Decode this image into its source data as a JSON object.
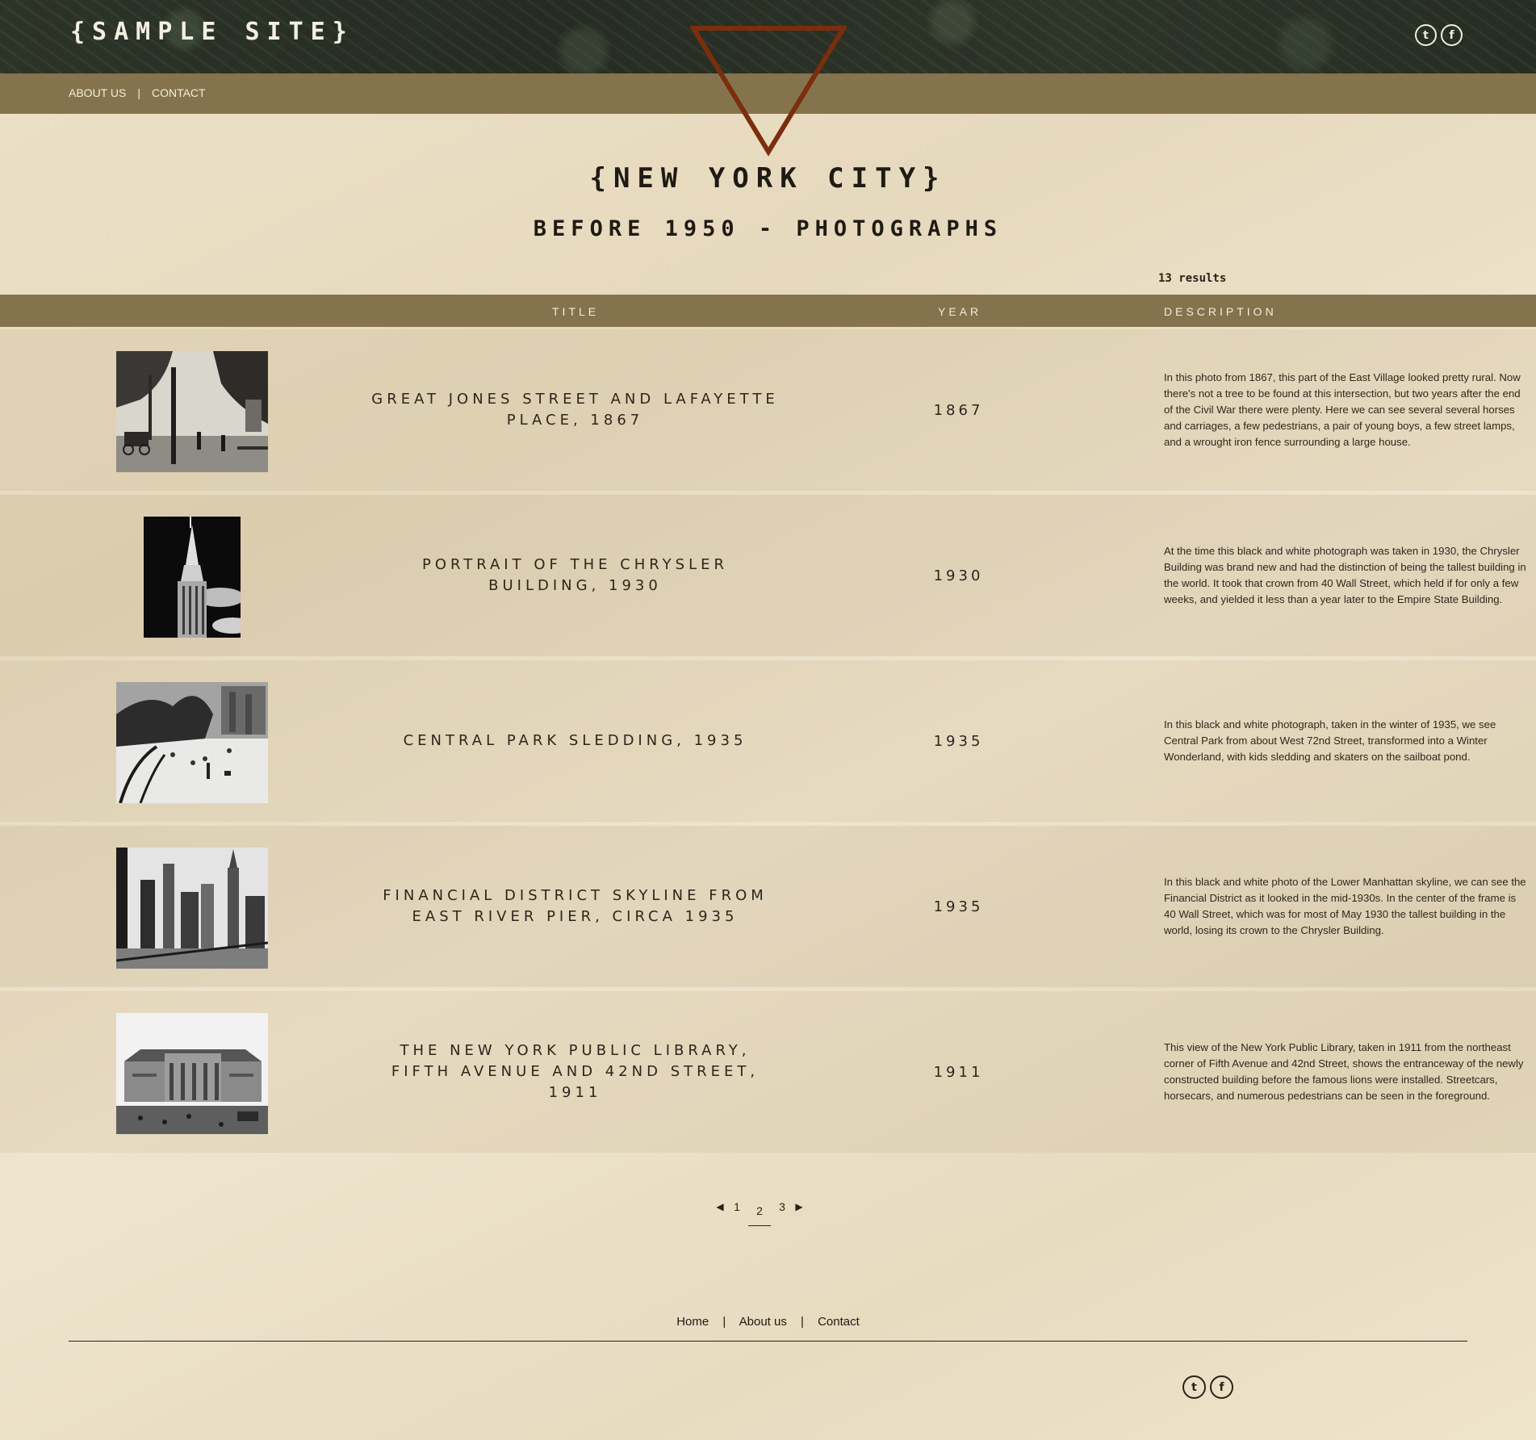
{
  "site": {
    "logo": "{SAMPLE SITE}"
  },
  "social": {
    "twitter_icon": "twitter-icon",
    "facebook_icon": "facebook-icon",
    "twitter_glyph": "t",
    "facebook_glyph": "f"
  },
  "nav": {
    "about": "ABOUT US",
    "separator": "|",
    "contact": "CONTACT"
  },
  "hero": {
    "city": "{NEW YORK CITY}",
    "subtitle": "BEFORE 1950 - PHOTOGRAPHS"
  },
  "results": {
    "count_text": "13 results"
  },
  "table": {
    "headers": {
      "title": "TITLE",
      "year": "YEAR",
      "description": "DESCRIPTION"
    },
    "rows": [
      {
        "title": "GREAT JONES STREET AND LAFAYETTE PLACE, 1867",
        "year": "1867",
        "description": "In this photo from 1867, this part of the East Village looked pretty rural. Now there's not a tree to be found at this intersection, but two years after the end of the Civil War there were plenty. Here we can see several several horses and carriages, a few pedestrians, a pair of young boys, a few street lamps, and a wrought iron fence surrounding a large house."
      },
      {
        "title": "PORTRAIT OF THE CHRYSLER BUILDING, 1930",
        "year": "1930",
        "description": "At the time this black and white photograph was taken in 1930, the Chrysler Building was brand new and had the distinction of being the tallest building in the world. It took that crown from 40 Wall Street, which held if for only a few weeks, and yielded it less than a year later to the Empire State Building."
      },
      {
        "title": "CENTRAL PARK SLEDDING, 1935",
        "year": "1935",
        "description": "In this black and white photograph, taken in the winter of 1935, we see Central Park from about West 72nd Street, transformed into a Winter Wonderland, with kids sledding and skaters on the sailboat pond."
      },
      {
        "title": "FINANCIAL DISTRICT SKYLINE FROM EAST RIVER PIER, CIRCA 1935",
        "year": "1935",
        "description": "In this black and white photo of the Lower Manhattan skyline, we can see the Financial District as it looked in the mid-1930s. In the center of the frame is 40 Wall Street, which was for most of May 1930 the tallest building in the world, losing its crown to the Chrysler Building."
      },
      {
        "title": "THE NEW YORK PUBLIC LIBRARY, FIFTH AVENUE AND 42ND STREET, 1911",
        "year": "1911",
        "description": "This view of the New York Public Library, taken in 1911 from the northeast corner of Fifth Avenue and 42nd Street, shows the entranceway of the newly constructed building before the famous lions were installed. Streetcars, horsecars, and numerous pedestrians can be seen in the foreground."
      }
    ]
  },
  "pagination": {
    "prev_icon": "caret-left-icon",
    "next_icon": "caret-right-icon",
    "pages": [
      "1",
      "2",
      "3"
    ],
    "current": "2"
  },
  "footer": {
    "home": "Home",
    "about": "About us",
    "contact": "Contact",
    "separator": "|"
  },
  "colors": {
    "nav_band": "#85734d",
    "header_dark": "#2a3125",
    "triangle": "#7a2e0e",
    "paper": "#ece1c8"
  }
}
